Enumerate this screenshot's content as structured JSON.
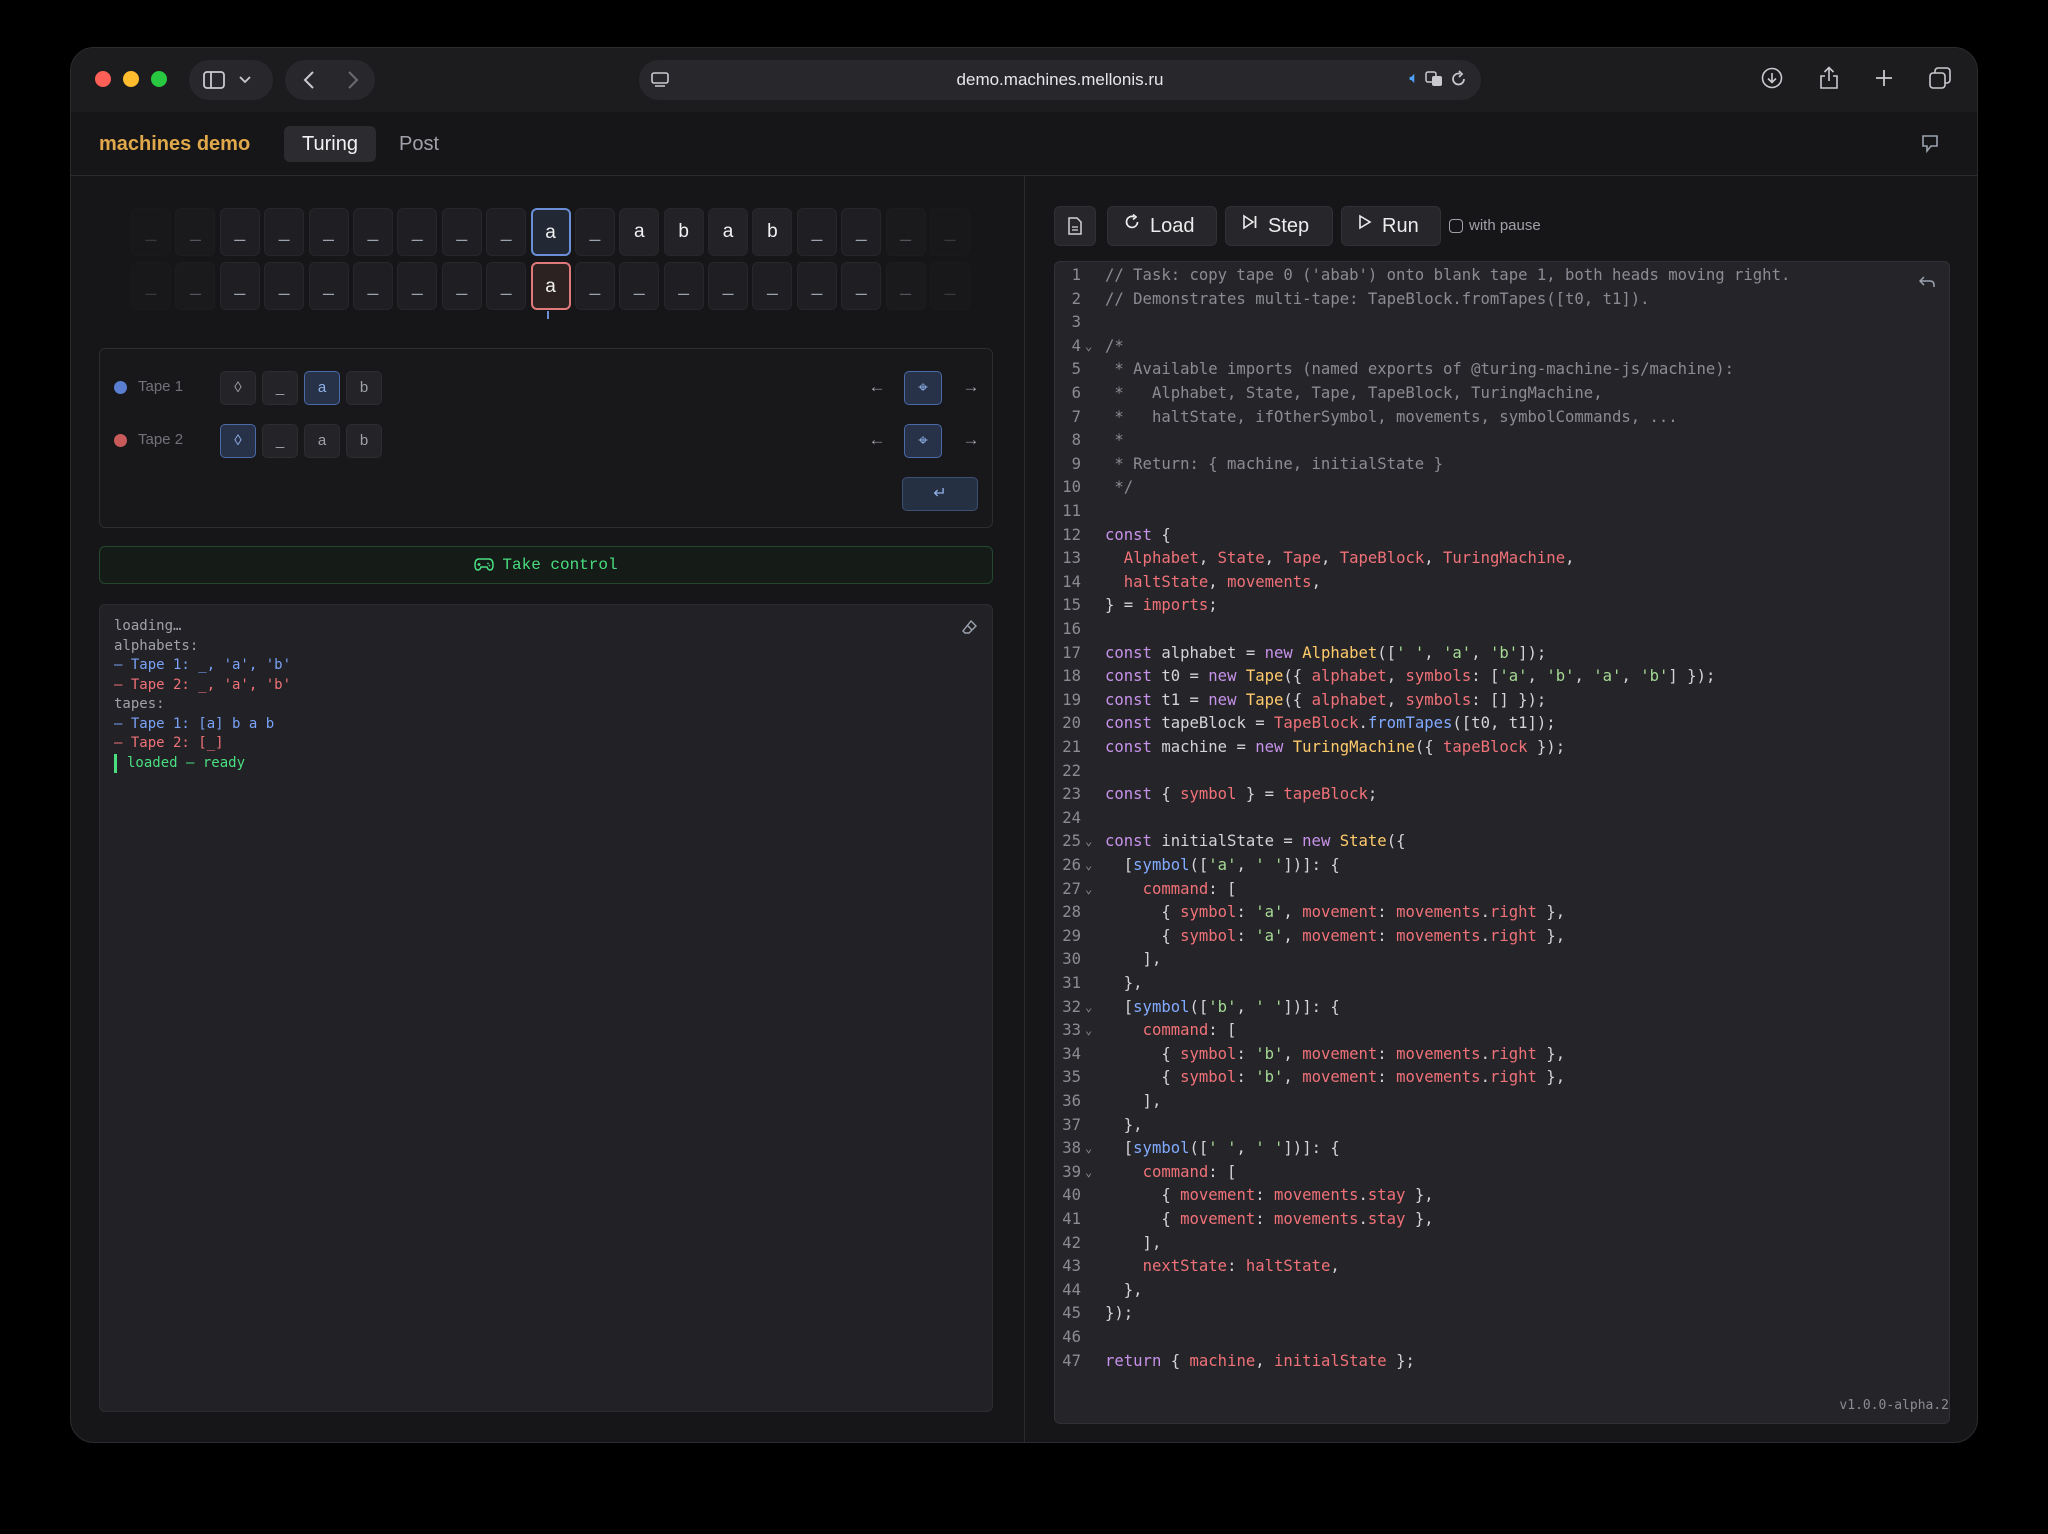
{
  "browser": {
    "url": "demo.machines.mellonis.ru"
  },
  "app": {
    "brand": "machines demo",
    "tabs": [
      {
        "label": "Turing",
        "active": true
      },
      {
        "label": "Post",
        "active": false
      }
    ]
  },
  "tapes": {
    "tape1_cells": [
      "_",
      "_",
      "_",
      "_",
      "_",
      "_",
      "_",
      "_",
      "_",
      "a",
      "_",
      "a",
      "b",
      "a",
      "b",
      "_",
      "_",
      "_",
      "_"
    ],
    "tape2_cells": [
      "_",
      "_",
      "_",
      "_",
      "_",
      "_",
      "_",
      "_",
      "_",
      "a",
      "_",
      "_",
      "_",
      "_",
      "_",
      "_",
      "_",
      "_",
      "_"
    ],
    "head_index": 9
  },
  "controls": {
    "rows": [
      {
        "label": "Tape 1",
        "color": "#5a7fd1",
        "symbols": [
          "◊",
          "_",
          "a",
          "b"
        ],
        "selected_symbol": 2,
        "moves": [
          "←",
          "⌖",
          "→"
        ],
        "selected_move": 1
      },
      {
        "label": "Tape 2",
        "color": "#c85a5a",
        "symbols": [
          "◊",
          "_",
          "a",
          "b"
        ],
        "selected_symbol": 0,
        "moves": [
          "←",
          "⌖",
          "→"
        ],
        "selected_move": 1
      }
    ],
    "enter_label": "↵",
    "take_control_label": "Take control"
  },
  "console": {
    "lines": [
      {
        "text": "loading…",
        "kind": "muted"
      },
      {
        "text": "alphabets:",
        "kind": "muted"
      },
      {
        "text": "– Tape 1: _, 'a', 'b'",
        "kind": "blue"
      },
      {
        "text": "– Tape 2: _, 'a', 'b'",
        "kind": "red"
      },
      {
        "text": "tapes:",
        "kind": "muted"
      },
      {
        "text": "– Tape 1: [a] b a b",
        "kind": "blue"
      },
      {
        "text": "– Tape 2: [_]",
        "kind": "red"
      },
      {
        "text": "loaded — ready",
        "kind": "green"
      }
    ]
  },
  "toolbar": {
    "load_label": "Load",
    "step_label": "Step",
    "run_label": "Run",
    "pause_label": "with pause"
  },
  "editor": {
    "lines": [
      [
        [
          "c-com",
          "// Task: copy tape 0 ('abab') onto blank tape 1, both heads moving right."
        ]
      ],
      [
        [
          "c-com",
          "// Demonstrates multi-tape: TapeBlock.fromTapes([t0, t1])."
        ]
      ],
      [],
      [
        [
          "c-com",
          "/*"
        ]
      ],
      [
        [
          "c-com",
          " * Available imports (named exports of @turing-machine-js/machine):"
        ]
      ],
      [
        [
          "c-com",
          " *   Alphabet, State, Tape, TapeBlock, TuringMachine,"
        ]
      ],
      [
        [
          "c-com",
          " *   haltState, ifOtherSymbol, movements, symbolCommands, ..."
        ]
      ],
      [
        [
          "c-com",
          " *"
        ]
      ],
      [
        [
          "c-com",
          " * Return: { machine, initialState }"
        ]
      ],
      [
        [
          "c-com",
          " */"
        ]
      ],
      [],
      [
        [
          "c-kw",
          "const"
        ],
        [
          "c-pl",
          " {"
        ]
      ],
      [
        [
          "c-pl",
          "  "
        ],
        [
          "c-id",
          "Alphabet"
        ],
        [
          "c-pl",
          ", "
        ],
        [
          "c-id",
          "State"
        ],
        [
          "c-pl",
          ", "
        ],
        [
          "c-id",
          "Tape"
        ],
        [
          "c-pl",
          ", "
        ],
        [
          "c-id",
          "TapeBlock"
        ],
        [
          "c-pl",
          ", "
        ],
        [
          "c-id",
          "TuringMachine"
        ],
        [
          "c-pl",
          ","
        ]
      ],
      [
        [
          "c-pl",
          "  "
        ],
        [
          "c-id",
          "haltState"
        ],
        [
          "c-pl",
          ", "
        ],
        [
          "c-id",
          "movements"
        ],
        [
          "c-pl",
          ","
        ]
      ],
      [
        [
          "c-pl",
          "} = "
        ],
        [
          "c-id",
          "imports"
        ],
        [
          "c-pl",
          ";"
        ]
      ],
      [],
      [
        [
          "c-kw",
          "const"
        ],
        [
          "c-pl",
          " alphabet = "
        ],
        [
          "c-kw",
          "new"
        ],
        [
          "c-pl",
          " "
        ],
        [
          "c-cls",
          "Alphabet"
        ],
        [
          "c-pl",
          "(["
        ],
        [
          "c-str",
          "' '"
        ],
        [
          "c-pl",
          ", "
        ],
        [
          "c-str",
          "'a'"
        ],
        [
          "c-pl",
          ", "
        ],
        [
          "c-str",
          "'b'"
        ],
        [
          "c-pl",
          "]);"
        ]
      ],
      [
        [
          "c-kw",
          "const"
        ],
        [
          "c-pl",
          " t0 = "
        ],
        [
          "c-kw",
          "new"
        ],
        [
          "c-pl",
          " "
        ],
        [
          "c-cls",
          "Tape"
        ],
        [
          "c-pl",
          "({ "
        ],
        [
          "c-id",
          "alphabet"
        ],
        [
          "c-pl",
          ", "
        ],
        [
          "c-id",
          "symbols"
        ],
        [
          "c-pl",
          ": ["
        ],
        [
          "c-str",
          "'a'"
        ],
        [
          "c-pl",
          ", "
        ],
        [
          "c-str",
          "'b'"
        ],
        [
          "c-pl",
          ", "
        ],
        [
          "c-str",
          "'a'"
        ],
        [
          "c-pl",
          ", "
        ],
        [
          "c-str",
          "'b'"
        ],
        [
          "c-pl",
          "] });"
        ]
      ],
      [
        [
          "c-kw",
          "const"
        ],
        [
          "c-pl",
          " t1 = "
        ],
        [
          "c-kw",
          "new"
        ],
        [
          "c-pl",
          " "
        ],
        [
          "c-cls",
          "Tape"
        ],
        [
          "c-pl",
          "({ "
        ],
        [
          "c-id",
          "alphabet"
        ],
        [
          "c-pl",
          ", "
        ],
        [
          "c-id",
          "symbols"
        ],
        [
          "c-pl",
          ": [] });"
        ]
      ],
      [
        [
          "c-kw",
          "const"
        ],
        [
          "c-pl",
          " tapeBlock = "
        ],
        [
          "c-id",
          "TapeBlock"
        ],
        [
          "c-pl",
          "."
        ],
        [
          "c-fn",
          "fromTapes"
        ],
        [
          "c-pl",
          "([t0, t1]);"
        ]
      ],
      [
        [
          "c-kw",
          "const"
        ],
        [
          "c-pl",
          " machine = "
        ],
        [
          "c-kw",
          "new"
        ],
        [
          "c-pl",
          " "
        ],
        [
          "c-cls",
          "TuringMachine"
        ],
        [
          "c-pl",
          "({ "
        ],
        [
          "c-id",
          "tapeBlock"
        ],
        [
          "c-pl",
          " });"
        ]
      ],
      [],
      [
        [
          "c-kw",
          "const"
        ],
        [
          "c-pl",
          " { "
        ],
        [
          "c-id",
          "symbol"
        ],
        [
          "c-pl",
          " } = "
        ],
        [
          "c-id",
          "tapeBlock"
        ],
        [
          "c-pl",
          ";"
        ]
      ],
      [],
      [
        [
          "c-kw",
          "const"
        ],
        [
          "c-pl",
          " initialState = "
        ],
        [
          "c-kw",
          "new"
        ],
        [
          "c-pl",
          " "
        ],
        [
          "c-cls",
          "State"
        ],
        [
          "c-pl",
          "({"
        ]
      ],
      [
        [
          "c-pl",
          "  ["
        ],
        [
          "c-fn",
          "symbol"
        ],
        [
          "c-pl",
          "(["
        ],
        [
          "c-str",
          "'a'"
        ],
        [
          "c-pl",
          ", "
        ],
        [
          "c-str",
          "' '"
        ],
        [
          "c-pl",
          "])]: {"
        ]
      ],
      [
        [
          "c-pl",
          "    "
        ],
        [
          "c-id",
          "command"
        ],
        [
          "c-pl",
          ": ["
        ]
      ],
      [
        [
          "c-pl",
          "      { "
        ],
        [
          "c-id",
          "symbol"
        ],
        [
          "c-pl",
          ": "
        ],
        [
          "c-str",
          "'a'"
        ],
        [
          "c-pl",
          ", "
        ],
        [
          "c-id",
          "movement"
        ],
        [
          "c-pl",
          ": "
        ],
        [
          "c-id",
          "movements"
        ],
        [
          "c-pl",
          "."
        ],
        [
          "c-id",
          "right"
        ],
        [
          "c-pl",
          " },"
        ]
      ],
      [
        [
          "c-pl",
          "      { "
        ],
        [
          "c-id",
          "symbol"
        ],
        [
          "c-pl",
          ": "
        ],
        [
          "c-str",
          "'a'"
        ],
        [
          "c-pl",
          ", "
        ],
        [
          "c-id",
          "movement"
        ],
        [
          "c-pl",
          ": "
        ],
        [
          "c-id",
          "movements"
        ],
        [
          "c-pl",
          "."
        ],
        [
          "c-id",
          "right"
        ],
        [
          "c-pl",
          " },"
        ]
      ],
      [
        [
          "c-pl",
          "    ],"
        ]
      ],
      [
        [
          "c-pl",
          "  },"
        ]
      ],
      [
        [
          "c-pl",
          "  ["
        ],
        [
          "c-fn",
          "symbol"
        ],
        [
          "c-pl",
          "(["
        ],
        [
          "c-str",
          "'b'"
        ],
        [
          "c-pl",
          ", "
        ],
        [
          "c-str",
          "' '"
        ],
        [
          "c-pl",
          "])]: {"
        ]
      ],
      [
        [
          "c-pl",
          "    "
        ],
        [
          "c-id",
          "command"
        ],
        [
          "c-pl",
          ": ["
        ]
      ],
      [
        [
          "c-pl",
          "      { "
        ],
        [
          "c-id",
          "symbol"
        ],
        [
          "c-pl",
          ": "
        ],
        [
          "c-str",
          "'b'"
        ],
        [
          "c-pl",
          ", "
        ],
        [
          "c-id",
          "movement"
        ],
        [
          "c-pl",
          ": "
        ],
        [
          "c-id",
          "movements"
        ],
        [
          "c-pl",
          "."
        ],
        [
          "c-id",
          "right"
        ],
        [
          "c-pl",
          " },"
        ]
      ],
      [
        [
          "c-pl",
          "      { "
        ],
        [
          "c-id",
          "symbol"
        ],
        [
          "c-pl",
          ": "
        ],
        [
          "c-str",
          "'b'"
        ],
        [
          "c-pl",
          ", "
        ],
        [
          "c-id",
          "movement"
        ],
        [
          "c-pl",
          ": "
        ],
        [
          "c-id",
          "movements"
        ],
        [
          "c-pl",
          "."
        ],
        [
          "c-id",
          "right"
        ],
        [
          "c-pl",
          " },"
        ]
      ],
      [
        [
          "c-pl",
          "    ],"
        ]
      ],
      [
        [
          "c-pl",
          "  },"
        ]
      ],
      [
        [
          "c-pl",
          "  ["
        ],
        [
          "c-fn",
          "symbol"
        ],
        [
          "c-pl",
          "(["
        ],
        [
          "c-str",
          "' '"
        ],
        [
          "c-pl",
          ", "
        ],
        [
          "c-str",
          "' '"
        ],
        [
          "c-pl",
          "])]: {"
        ]
      ],
      [
        [
          "c-pl",
          "    "
        ],
        [
          "c-id",
          "command"
        ],
        [
          "c-pl",
          ": ["
        ]
      ],
      [
        [
          "c-pl",
          "      { "
        ],
        [
          "c-id",
          "movement"
        ],
        [
          "c-pl",
          ": "
        ],
        [
          "c-id",
          "movements"
        ],
        [
          "c-pl",
          "."
        ],
        [
          "c-id",
          "stay"
        ],
        [
          "c-pl",
          " },"
        ]
      ],
      [
        [
          "c-pl",
          "      { "
        ],
        [
          "c-id",
          "movement"
        ],
        [
          "c-pl",
          ": "
        ],
        [
          "c-id",
          "movements"
        ],
        [
          "c-pl",
          "."
        ],
        [
          "c-id",
          "stay"
        ],
        [
          "c-pl",
          " },"
        ]
      ],
      [
        [
          "c-pl",
          "    ],"
        ]
      ],
      [
        [
          "c-pl",
          "    "
        ],
        [
          "c-id",
          "nextState"
        ],
        [
          "c-pl",
          ": "
        ],
        [
          "c-id",
          "haltState"
        ],
        [
          "c-pl",
          ","
        ]
      ],
      [
        [
          "c-pl",
          "  },"
        ]
      ],
      [
        [
          "c-pl",
          "});"
        ]
      ],
      [],
      [
        [
          "c-kw",
          "return"
        ],
        [
          "c-pl",
          " { "
        ],
        [
          "c-id",
          "machine"
        ],
        [
          "c-pl",
          ", "
        ],
        [
          "c-id",
          "initialState"
        ],
        [
          "c-pl",
          " };"
        ]
      ]
    ],
    "fold_lines": [
      4,
      25,
      26,
      27,
      32,
      33,
      38,
      39
    ]
  },
  "version": "v1.0.0-alpha.2"
}
